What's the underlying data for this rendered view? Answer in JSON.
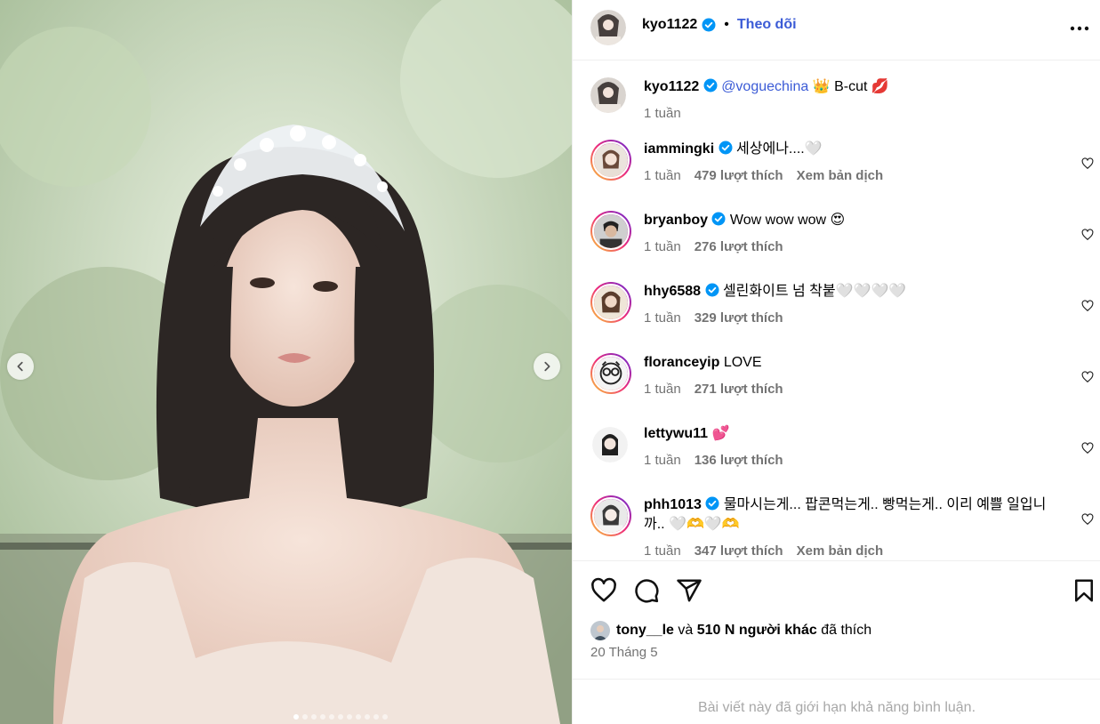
{
  "post": {
    "author": "kyo1122",
    "follow_label": "Theo dõi",
    "caption_mention": "@voguechina",
    "caption_text": "👑 B-cut 💋",
    "caption_time": "1 tuần"
  },
  "comments": [
    {
      "user": "iammingki",
      "verified": true,
      "text": "세상에나....🤍",
      "time": "1 tuần",
      "likes": "479 lượt thích",
      "extra": "Xem bản dịch"
    },
    {
      "user": "bryanboy",
      "verified": true,
      "text": "Wow wow wow 😍",
      "time": "1 tuần",
      "likes": "276 lượt thích",
      "extra": ""
    },
    {
      "user": "hhy6588",
      "verified": true,
      "text": "셀린화이트 넘 착붙🤍🤍🤍🤍",
      "time": "1 tuần",
      "likes": "329 lượt thích",
      "extra": ""
    },
    {
      "user": "floranceyip",
      "verified": false,
      "text": "LOVE",
      "time": "1 tuần",
      "likes": "271 lượt thích",
      "extra": ""
    },
    {
      "user": "lettywu11",
      "verified": false,
      "text": "💕",
      "time": "1 tuần",
      "likes": "136 lượt thích",
      "extra": ""
    },
    {
      "user": "phh1013",
      "verified": true,
      "text": "물마시는게... 팝콘먹는게.. 빵먹는게.. 이리 예쁠 일입니까.. 🤍🫶🤍🫶",
      "time": "1 tuần",
      "likes": "347 lượt thích",
      "extra": "Xem bản dịch"
    }
  ],
  "liked_by": {
    "user": "tony__le",
    "connector": "và",
    "others": "510 N người khác",
    "suffix": "đã thích"
  },
  "date": "20 Tháng 5",
  "comments_limited": "Bài viết này đã giới hạn khả năng bình luận.",
  "colors": {
    "link": "#3b5bd6",
    "verified": "#0095f6",
    "muted": "#737373"
  },
  "icons": [
    "heart-icon",
    "comment-icon",
    "share-icon",
    "bookmark-icon",
    "more-icon",
    "chevron-left-icon",
    "chevron-right-icon"
  ]
}
